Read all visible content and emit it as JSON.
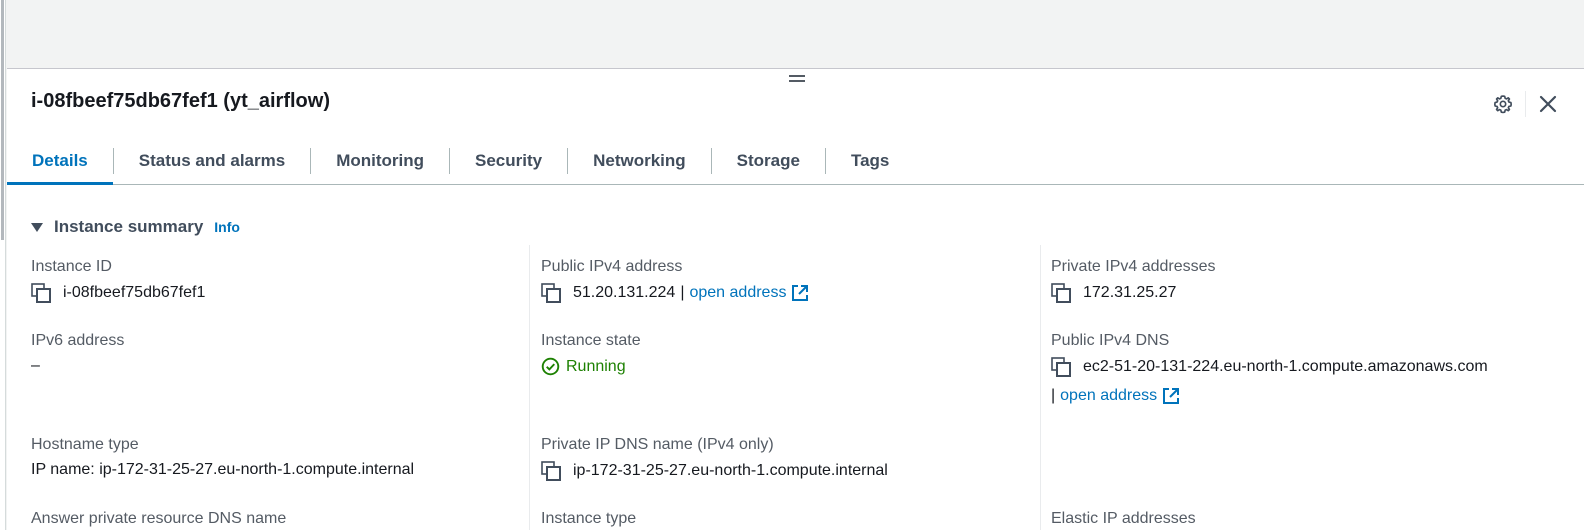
{
  "panel": {
    "title": "i-08fbeef75db67fef1 (yt_airflow)",
    "icons": {
      "settings": "gear-icon",
      "close": "close-icon",
      "drag": "drag-handle-icon"
    }
  },
  "tabs": [
    {
      "label": "Details",
      "active": true
    },
    {
      "label": "Status and alarms",
      "active": false
    },
    {
      "label": "Monitoring",
      "active": false
    },
    {
      "label": "Security",
      "active": false
    },
    {
      "label": "Networking",
      "active": false
    },
    {
      "label": "Storage",
      "active": false
    },
    {
      "label": "Tags",
      "active": false
    }
  ],
  "summary": {
    "title": "Instance summary",
    "info_label": "Info",
    "fields": {
      "instance_id": {
        "label": "Instance ID",
        "value": "i-08fbeef75db67fef1"
      },
      "ipv6": {
        "label": "IPv6 address",
        "value": "–"
      },
      "hostname_type": {
        "label": "Hostname type",
        "value": "IP name: ip-172-31-25-27.eu-north-1.compute.internal"
      },
      "answer_dns": {
        "label": "Answer private resource DNS name"
      },
      "public_ipv4": {
        "label": "Public IPv4 address",
        "value": "51.20.131.224",
        "separator": "|",
        "link": "open address"
      },
      "instance_state": {
        "label": "Instance state",
        "value": "Running"
      },
      "private_ip_dns": {
        "label": "Private IP DNS name (IPv4 only)",
        "value": "ip-172-31-25-27.eu-north-1.compute.internal"
      },
      "instance_type": {
        "label": "Instance type"
      },
      "private_ipv4": {
        "label": "Private IPv4 addresses",
        "value": "172.31.25.27"
      },
      "public_dns": {
        "label": "Public IPv4 DNS",
        "value": "ec2-51-20-131-224.eu-north-1.compute.amazonaws.com",
        "separator": "|",
        "link": "open address"
      },
      "elastic_ip": {
        "label": "Elastic IP addresses"
      }
    }
  },
  "colors": {
    "accent": "#0073bb",
    "running": "#1d8102",
    "label": "#545b64",
    "text": "#16191f"
  }
}
